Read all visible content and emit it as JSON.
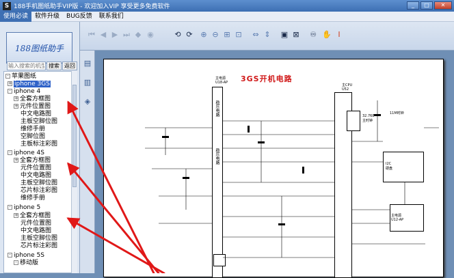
{
  "window": {
    "title": "188手机图纸助手VIP版 - 欢迎加入VIP 享受更多免费软件",
    "icon_letter": "S"
  },
  "menu": [
    "使用必读",
    "软件升级",
    "BUG反馈",
    "联系我们"
  ],
  "logo_text": "188图纸助手",
  "search": {
    "placeholder": "输入搜索的机型",
    "search_label": "搜索",
    "back_label": "返回"
  },
  "tree": {
    "root": "苹果图纸",
    "iphone3gs": "iphone 3GS",
    "iphone4": "iphone 4",
    "iphone4_items": [
      "全套方框图",
      "元件位置图",
      "中文电路图",
      "主板空脚位图",
      "维修手册",
      "空脚位图",
      "主板标注彩图"
    ],
    "iphone4s": "iphone 4S",
    "iphone4s_items": [
      "全套方框图",
      "元件位置图",
      "中文电路图",
      "主板空脚位图",
      "芯片标注彩图",
      "维修手册"
    ],
    "iphone5": "iphone 5",
    "iphone5_items": [
      "全套方框图",
      "元件位置图",
      "中文电路图",
      "主板空脚位图",
      "芯片标注彩图"
    ],
    "iphone5s": "iphone 5S",
    "iphone5s_items": [
      "移动版"
    ]
  },
  "schematic": {
    "title": "3GS开机电路",
    "left_chip": "主电源\nU18-AP",
    "left_block": "稳压电路",
    "left_block2": "稳压电路",
    "cpu_label": "主CPU\nU52",
    "right_block": "32.768\n主时钟",
    "right_block2": "11M时钟",
    "right_block3": "I2C\n硬盘",
    "right_block4": "主电源\nU12-AP"
  }
}
